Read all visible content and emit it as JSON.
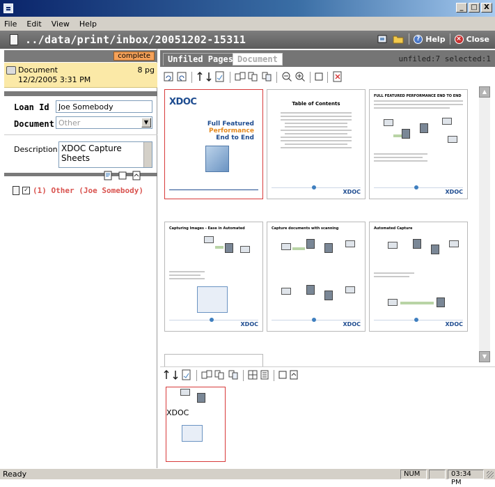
{
  "window": {
    "min_label": "_",
    "max_label": "□",
    "close_label": "X"
  },
  "menu": [
    "File",
    "Edit",
    "View",
    "Help"
  ],
  "pathbar": {
    "path": "../data/print/inbox/20051202-15311",
    "help_label": "Help",
    "close_label": "Close"
  },
  "left": {
    "status_badge": "complete",
    "document": {
      "name": "Document",
      "pages": "8 pg",
      "date": "12/2/2005 3:31 PM"
    },
    "loan_id_label": "Loan Id",
    "loan_id_value": "Joe Somebody",
    "document_label": "Document",
    "document_value": "Other",
    "description_label": "Description",
    "description_value": "XDOC Capture Sheets",
    "tree_item": "(1) Other (Joe Somebody)"
  },
  "right": {
    "tab_unfiled": "Unfiled Pages",
    "tab_document": "Document",
    "unfiled_count": "unfiled:7",
    "selected_count": "selected:1"
  },
  "pages": {
    "cover_logo": "XDOC",
    "cover_line1": "Full Featured",
    "cover_line2": "Performance",
    "cover_line3": "End to End",
    "toc_title": "Table of Contents",
    "page3_title": "FULL FEATURED PERFORMANCE END TO END",
    "page4_title": "Capturing Images - Ease in Automated",
    "page5_title": "Capture documents with scanning",
    "page6_title": "Automated Capture",
    "footer_logo": "XDOC"
  },
  "statusbar": {
    "ready": "Ready",
    "num": "NUM",
    "time": "03:34 PM"
  },
  "colors": {
    "accent_red": "#d73a3a",
    "badge_orange": "#f5a25a",
    "doc_highlight": "#fbe9a7",
    "brand_blue": "#1d4b8f"
  }
}
